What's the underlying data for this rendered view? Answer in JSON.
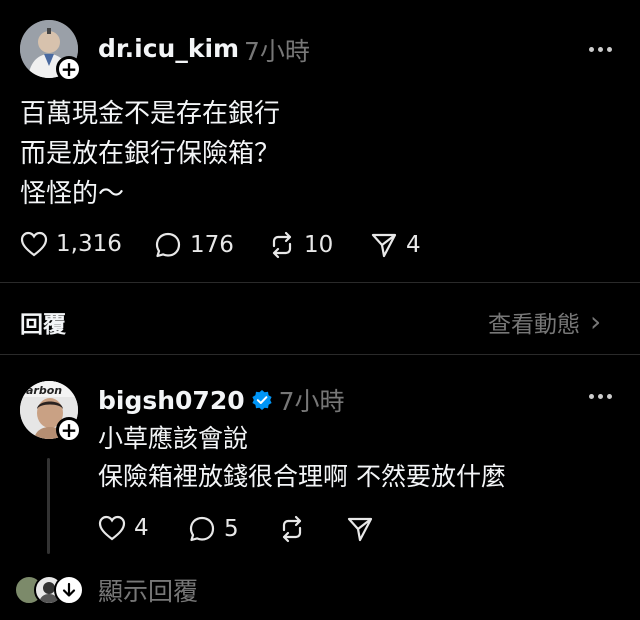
{
  "post": {
    "username": "dr.icu_kim",
    "time": "7小時",
    "lines": [
      "百萬現金不是存在銀行",
      "而是放在銀行保險箱？",
      "怪怪的～"
    ],
    "likes": "1,316",
    "comments": "176",
    "reposts": "10",
    "shares": "4"
  },
  "replies_bar": {
    "label": "回覆",
    "activity_link": "查看動態",
    "activity_chevron": "›"
  },
  "reply": {
    "username": "bigsh0720",
    "time": "7小時",
    "verified": true,
    "lines": [
      "小草應該會說",
      "保險箱裡放錢很合理啊 不然要放什麼"
    ],
    "likes": "4",
    "comments": "5"
  },
  "show_replies": {
    "label": "顯示回覆"
  },
  "colors": {
    "background": "#000000",
    "text": "#f3f5f7",
    "muted": "#777777",
    "verified": "#0095f6"
  },
  "icons": [
    "heart-icon",
    "comment-icon",
    "repost-icon",
    "share-icon",
    "more-icon",
    "plus-icon",
    "verified-icon",
    "chevron-right-icon",
    "down-arrow-icon"
  ]
}
